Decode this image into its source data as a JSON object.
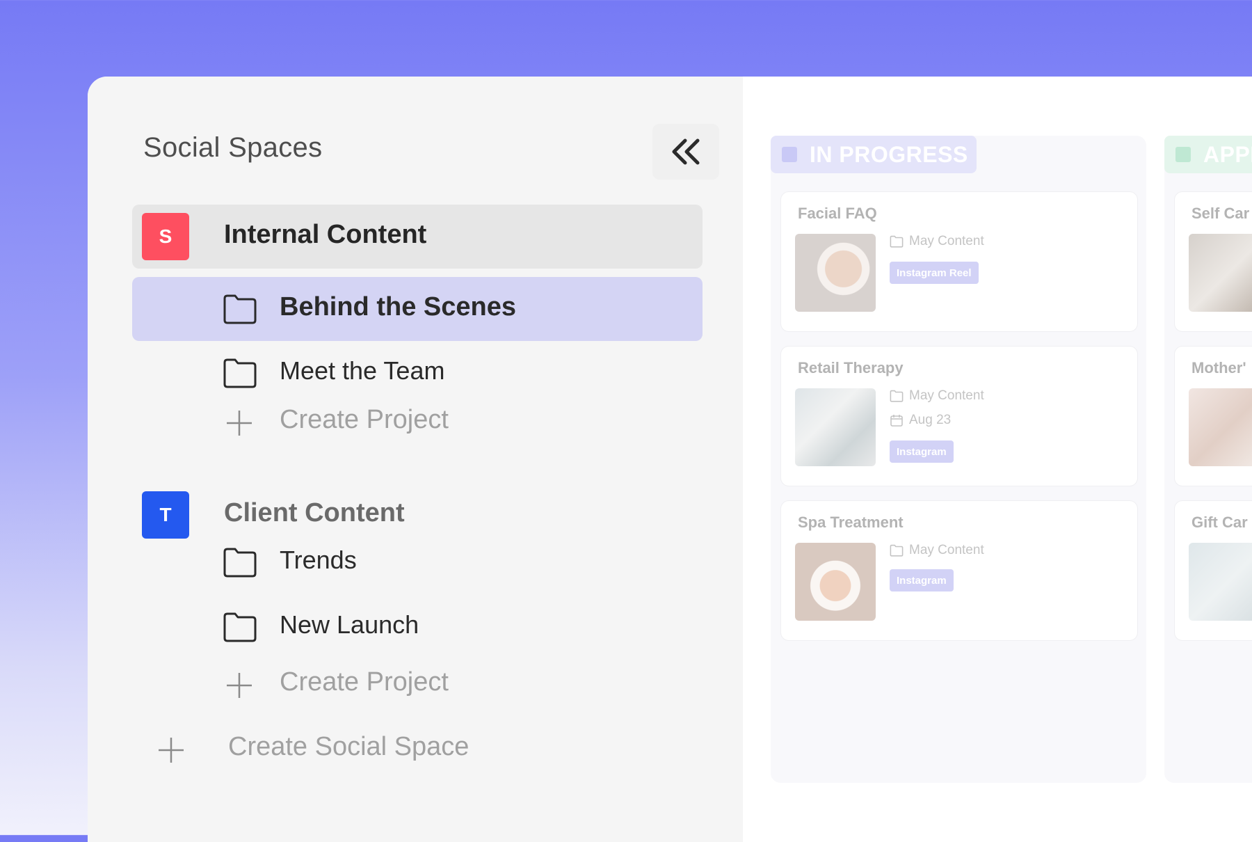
{
  "sidebar": {
    "title": "Social Spaces",
    "spaces": [
      {
        "badge": "S",
        "badge_color": "#fe4f60",
        "name": "Internal Content",
        "projects": [
          {
            "label": "Behind the Scenes",
            "selected": true
          },
          {
            "label": "Meet the Team",
            "selected": false
          }
        ],
        "create_project_label": "Create Project"
      },
      {
        "badge": "T",
        "badge_color": "#2459ef",
        "name": "Client Content",
        "projects": [
          {
            "label": "Trends",
            "selected": false
          },
          {
            "label": "New Launch",
            "selected": false
          }
        ],
        "create_project_label": "Create Project"
      }
    ],
    "create_space_label": "Create Social Space"
  },
  "board": {
    "columns": [
      {
        "title": "IN PROGRESS",
        "color": "#c9c9f6",
        "header_bg": "#e4e4fa",
        "cards": [
          {
            "title": "Facial FAQ",
            "folder": "May Content",
            "date": "",
            "tag": "Instagram Reel"
          },
          {
            "title": "Retail Therapy",
            "folder": "May Content",
            "date": "Aug 23",
            "tag": "Instagram"
          },
          {
            "title": "Spa Treatment",
            "folder": "May Content",
            "date": "",
            "tag": "Instagram"
          }
        ]
      },
      {
        "title": "APPR",
        "color": "#bfe8d3",
        "header_bg": "#e4f5ec",
        "cards": [
          {
            "title": "Self Car"
          },
          {
            "title": "Mother'"
          },
          {
            "title": "Gift Car"
          }
        ]
      }
    ]
  },
  "colors": {
    "accent": "#7a7ef5",
    "selected_row": "#d4d4f4",
    "active_space_row": "#e6e6e6"
  }
}
